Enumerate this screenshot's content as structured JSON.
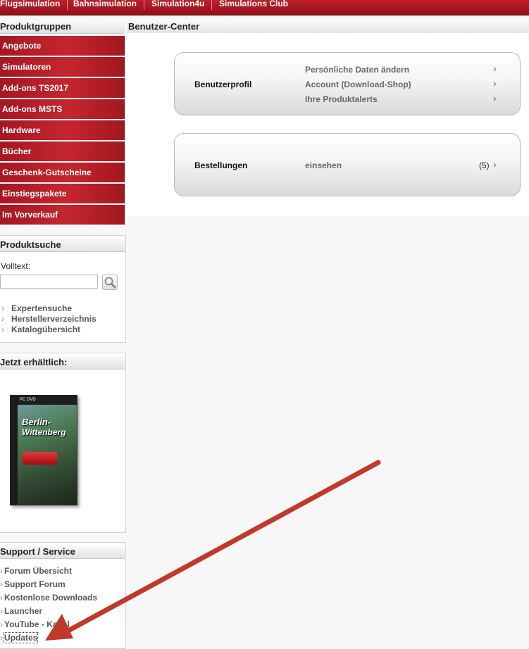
{
  "topnav": {
    "items": [
      "Flugsimulation",
      "Bahnsimulation",
      "Simulation4u",
      "Simulations Club"
    ]
  },
  "sidebar": {
    "groups_header": "Produktgruppen",
    "menu": [
      "Angebote",
      "Simulatoren",
      "Add-ons TS2017",
      "Add-ons MSTS",
      "Hardware",
      "Bücher",
      "Geschenk-Gutscheine",
      "Einstiegspakete",
      "Im Vorverkauf"
    ],
    "search": {
      "header": "Produktsuche",
      "label": "Volltext:",
      "value": "",
      "links": [
        "Expertensuche",
        "Herstellerverzeichnis",
        "Katalogübersicht"
      ]
    },
    "available": {
      "header": "Jetzt erhältlich:",
      "product_title_1": "Berlin-",
      "product_title_2": "Wittenberg",
      "product_band": "PC DVD"
    },
    "support": {
      "header": "Support / Service",
      "links": [
        "Forum Übersicht",
        "Support Forum",
        "Kostenlose Downloads",
        "Launcher",
        "YouTube - Kanal",
        "Updates"
      ]
    }
  },
  "main": {
    "header": "Benutzer-Center",
    "profile": {
      "title": "Benutzerprofil",
      "links": [
        "Persönliche Daten ändern",
        "Account (Download-Shop)",
        "Ihre Produktalerts"
      ]
    },
    "orders": {
      "title": "Bestellungen",
      "link": "einsehen",
      "count": "(5)"
    }
  },
  "colors": {
    "brand_red": "#b51c25",
    "annotation_arrow": "#c0392b"
  }
}
